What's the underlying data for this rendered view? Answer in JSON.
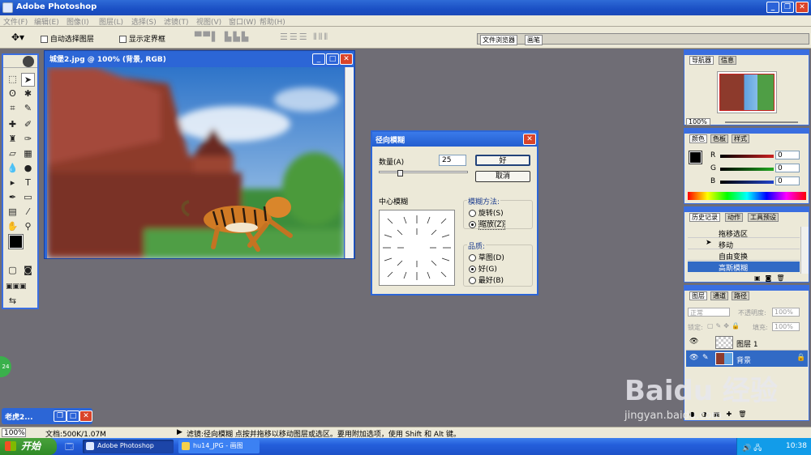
{
  "app": {
    "title": "Adobe Photoshop"
  },
  "menu": [
    "文件(F)",
    "编辑(E)",
    "图像(I)",
    "图层(L)",
    "选择(S)",
    "滤镜(T)",
    "视图(V)",
    "窗口(W)",
    "帮助(H)"
  ],
  "options_bar": {
    "auto_select_label": "自动选择图层",
    "show_bounds_label": "显示定界框",
    "file_browser_tab": "文件浏览器",
    "brushes_tab": "画笔"
  },
  "document": {
    "title": "城堡2.jpg @ 100% (背景, RGB)"
  },
  "dialog": {
    "title": "径向模糊",
    "amount_label": "数量(A)",
    "amount_value": "25",
    "ok_label": "好",
    "cancel_label": "取消",
    "center_label": "中心模糊",
    "method_label": "模糊方法:",
    "method_options": [
      "旋转(S)",
      "缩放(Z)"
    ],
    "method_selected": 1,
    "quality_label": "品质:",
    "quality_options": [
      "草图(D)",
      "好(G)",
      "最好(B)"
    ],
    "quality_selected": 1
  },
  "navigator": {
    "tabs": [
      "导航器",
      "信息"
    ],
    "zoom": "100%"
  },
  "color_panel": {
    "tabs": [
      "颜色",
      "色板",
      "样式"
    ],
    "channels": [
      {
        "label": "R",
        "value": "0",
        "color": "#cc2222"
      },
      {
        "label": "G",
        "value": "0",
        "color": "#22aa22"
      },
      {
        "label": "B",
        "value": "0",
        "color": "#2244cc"
      }
    ]
  },
  "history_panel": {
    "tabs": [
      "历史记录",
      "动作",
      "工具预设"
    ],
    "items": [
      "拖移选区",
      "移动",
      "自由变换",
      "高斯模糊"
    ],
    "selected": 3
  },
  "layers_panel": {
    "tabs": [
      "图层",
      "通道",
      "路径"
    ],
    "blend_mode": "正常",
    "opacity_label": "不透明度:",
    "opacity_value": "100%",
    "lock_label": "锁定:",
    "fill_label": "填充:",
    "fill_value": "100%",
    "layers": [
      {
        "name": "图层 1",
        "selected": false
      },
      {
        "name": "背景",
        "selected": true
      }
    ]
  },
  "minimized_doc": {
    "title": "老虎2..."
  },
  "status": {
    "zoom": "100%",
    "doc_size": "文档:500K/1.07M",
    "hint": "滤镜:径向模糊   点按并拖移以移动图层或选区。要用附加选项，使用 Shift 和 Alt 键。"
  },
  "taskbar": {
    "start_label": "开始",
    "items": [
      "Adobe Photoshop",
      "hu14_JPG - 画图"
    ],
    "clock": "10:38"
  },
  "side_badge": "24",
  "watermark": {
    "brand": "Baidu 经验",
    "url": "jingyan.baidu.com"
  }
}
